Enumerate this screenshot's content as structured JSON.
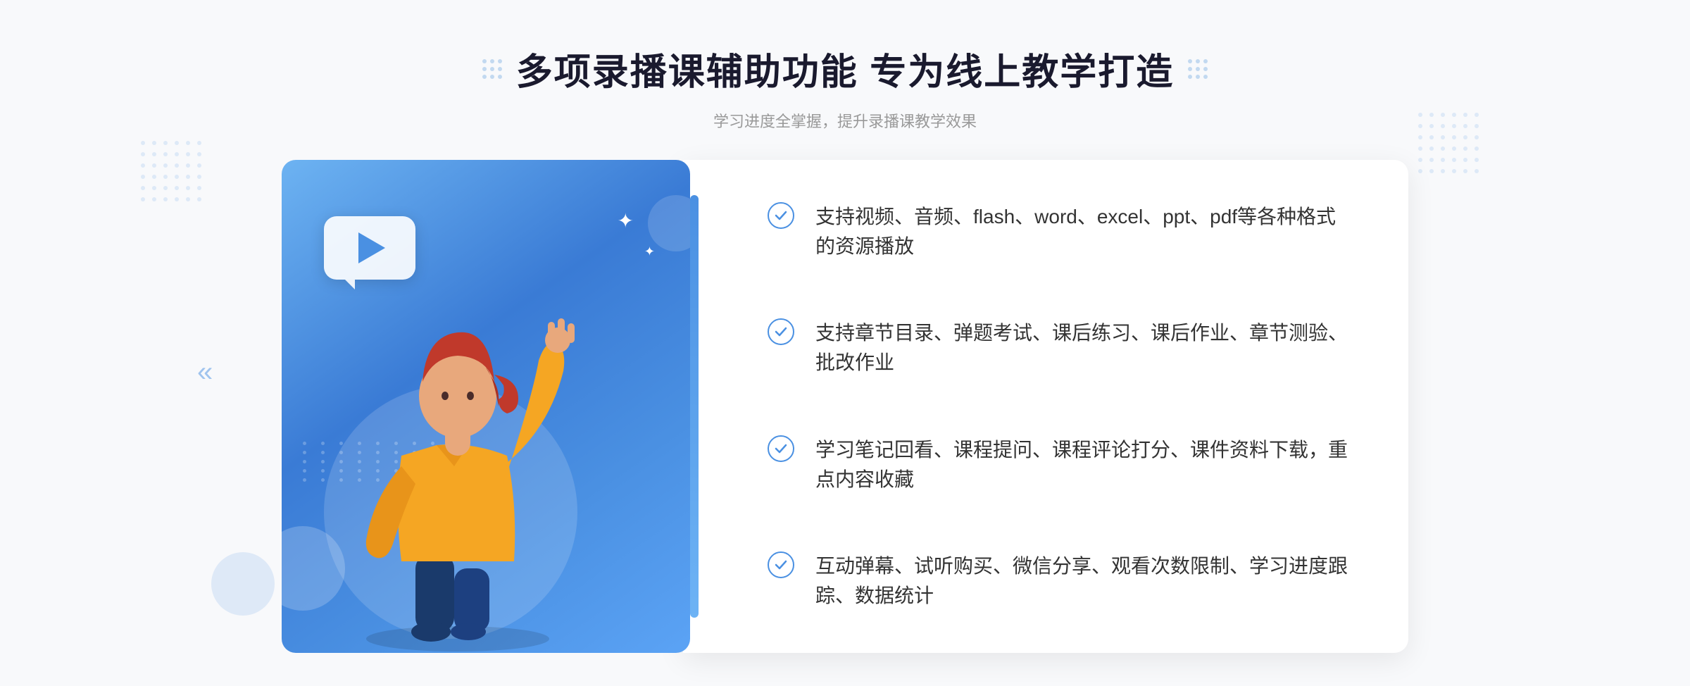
{
  "header": {
    "main_title": "多项录播课辅助功能 专为线上教学打造",
    "sub_title": "学习进度全掌握，提升录播课教学效果"
  },
  "decorations": {
    "left_chevrons": "«",
    "right_chevrons": "::"
  },
  "features": [
    {
      "id": 1,
      "text": "支持视频、音频、flash、word、excel、ppt、pdf等各种格式的资源播放"
    },
    {
      "id": 2,
      "text": "支持章节目录、弹题考试、课后练习、课后作业、章节测验、批改作业"
    },
    {
      "id": 3,
      "text": "学习笔记回看、课程提问、课程评论打分、课件资料下载，重点内容收藏"
    },
    {
      "id": 4,
      "text": "互动弹幕、试听购买、微信分享、观看次数限制、学习进度跟踪、数据统计"
    }
  ]
}
